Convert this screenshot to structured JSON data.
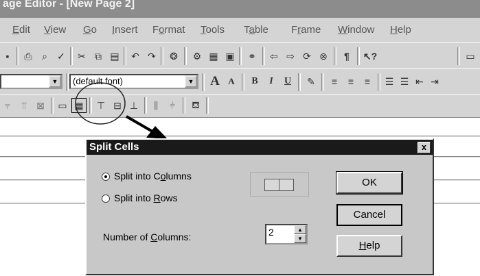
{
  "window": {
    "title": "age Editor - [New Page 2]"
  },
  "menu": [
    {
      "label": "Edit",
      "key": "E",
      "rest": "dit"
    },
    {
      "label": "View",
      "key": "V",
      "rest": "iew"
    },
    {
      "label": "Go",
      "key": "G",
      "rest": "o"
    },
    {
      "label": "Insert",
      "key": "I",
      "rest": "nsert"
    },
    {
      "label": "Format",
      "pre": "F",
      "key": "o",
      "rest": "rmat"
    },
    {
      "label": "Tools",
      "key": "T",
      "rest": "ools"
    },
    {
      "label": "Table",
      "pre": "T",
      "key": "a",
      "rest": "ble"
    },
    {
      "label": "Frame",
      "pre": "F",
      "key": "r",
      "rest": "ame"
    },
    {
      "label": "Window",
      "key": "W",
      "rest": "indow"
    },
    {
      "label": "Help",
      "key": "H",
      "rest": "elp"
    }
  ],
  "toolbar": {
    "font_combo_value": "(default font)",
    "grow_font_glyph": "A",
    "shrink_font_glyph": "A",
    "bold_glyph": "B",
    "italic_glyph": "I",
    "underline_glyph": "U",
    "show_all_glyph": "¶",
    "help_glyph": "?"
  },
  "dialog": {
    "title": "Split Cells",
    "close_glyph": "x",
    "option_columns": {
      "pre": "Split into C",
      "key": "o",
      "rest": "lumns",
      "selected": true
    },
    "option_rows": {
      "pre": "Split into ",
      "key": "R",
      "rest": "ows",
      "selected": false
    },
    "number_label": {
      "pre": "Number of ",
      "key": "C",
      "rest": "olumns:"
    },
    "number_value": "2",
    "ok_label": "OK",
    "cancel_label": "Cancel",
    "help_label": {
      "key": "H",
      "rest": "elp"
    }
  },
  "icons": [
    "split-cells-icon",
    "arrow-annotation-icon",
    "circle-annotation-icon"
  ]
}
